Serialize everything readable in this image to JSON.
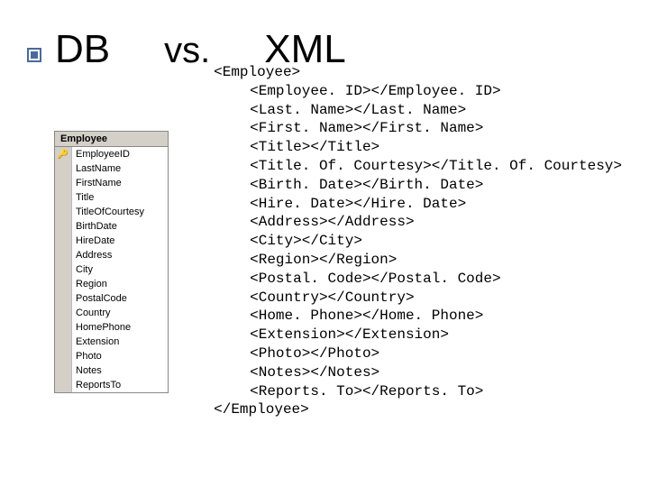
{
  "heading": {
    "db": "DB",
    "vs": "vs.",
    "xml": "XML"
  },
  "db_panel": {
    "title": "Employee",
    "key_field_index": 0,
    "fields": [
      "EmployeeID",
      "LastName",
      "FirstName",
      "Title",
      "TitleOfCourtesy",
      "BirthDate",
      "HireDate",
      "Address",
      "City",
      "Region",
      "PostalCode",
      "Country",
      "HomePhone",
      "Extension",
      "Photo",
      "Notes",
      "ReportsTo"
    ]
  },
  "xml": {
    "root_open": "<Employee>",
    "root_close": "</Employee>",
    "lines": [
      "<Employee. ID></Employee. ID>",
      "<Last. Name></Last. Name>",
      "<First. Name></First. Name>",
      "<Title></Title>",
      "<Title. Of. Courtesy></Title. Of. Courtesy>",
      "<Birth. Date></Birth. Date>",
      "<Hire. Date></Hire. Date>",
      "<Address></Address>",
      "<City></City>",
      "<Region></Region>",
      "<Postal. Code></Postal. Code>",
      "<Country></Country>",
      "<Home. Phone></Home. Phone>",
      "<Extension></Extension>",
      "<Photo></Photo>",
      "<Notes></Notes>",
      "<Reports. To></Reports. To>"
    ]
  }
}
